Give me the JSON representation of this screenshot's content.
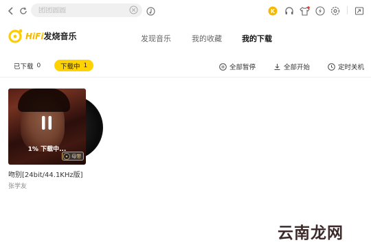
{
  "toolbar": {
    "search_placeholder": "团团圆圆"
  },
  "logo": {
    "hifi": "HiFi",
    "name": "发烧音乐"
  },
  "main_tabs": [
    {
      "label": "发现音乐",
      "active": false
    },
    {
      "label": "我的收藏",
      "active": false
    },
    {
      "label": "我的下载",
      "active": true
    }
  ],
  "sub_tabs": [
    {
      "label": "已下载",
      "count": "0",
      "active": false
    },
    {
      "label": "下载中",
      "count": "1",
      "active": true
    }
  ],
  "actions": {
    "pause_all": "全部暂停",
    "start_all": "全部开始",
    "shutdown_timer": "定时关机"
  },
  "download_item": {
    "progress_text": "1% 下载中...",
    "badge": "母带",
    "title": "吻别[24bit/44.1KHz版]",
    "artist": "张学友"
  },
  "watermark": "云南龙网",
  "colors": {
    "accent": "#ffd200",
    "vip_badge": "#f6b800"
  }
}
